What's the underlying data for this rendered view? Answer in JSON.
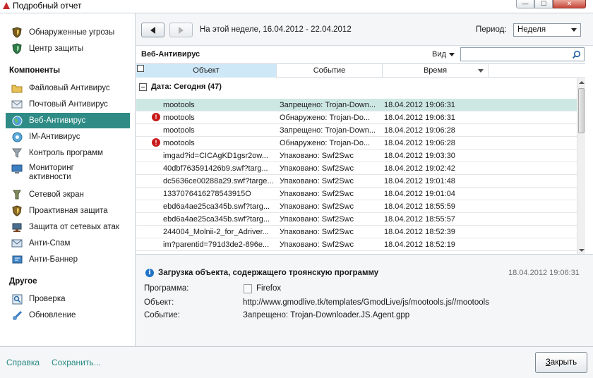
{
  "window": {
    "title": "Подробный отчет",
    "min_glyph": "—",
    "max_glyph": "☐",
    "close_glyph": "✕"
  },
  "sidebar": {
    "top_items": [
      {
        "label": "Обнаруженные угрозы",
        "icon": "shield-threat-icon"
      },
      {
        "label": "Центр защиты",
        "icon": "shield-center-icon"
      }
    ],
    "components_header": "Компоненты",
    "components": [
      {
        "label": "Файловый Антивирус",
        "icon": "folder-icon"
      },
      {
        "label": "Почтовый Антивирус",
        "icon": "envelope-icon"
      },
      {
        "label": "Веб-Антивирус",
        "icon": "globe-icon",
        "selected": true
      },
      {
        "label": "IM-Антивирус",
        "icon": "im-icon"
      },
      {
        "label": "Контроль программ",
        "icon": "filter-icon"
      },
      {
        "label": "Мониторинг активности",
        "icon": "monitor-icon"
      },
      {
        "label": "Сетевой экран",
        "icon": "firewall-icon"
      },
      {
        "label": "Проактивная защита",
        "icon": "proactive-shield-icon"
      },
      {
        "label": "Защита от сетевых атак",
        "icon": "network-attack-icon"
      },
      {
        "label": "Анти-Спам",
        "icon": "antispam-icon"
      },
      {
        "label": "Анти-Баннер",
        "icon": "antibanner-icon"
      }
    ],
    "other_header": "Другое",
    "other": [
      {
        "label": "Проверка",
        "icon": "scan-icon"
      },
      {
        "label": "Обновление",
        "icon": "update-icon"
      }
    ]
  },
  "nav": {
    "period_text": "На этой неделе, 16.04.2012 - 22.04.2012",
    "period_label": "Период:",
    "period_value": "Неделя"
  },
  "section": {
    "title": "Веб-Антивирус",
    "view_label": "Вид",
    "search_placeholder": ""
  },
  "table": {
    "columns": [
      "Объект",
      "Событие",
      "Время"
    ],
    "group_label": "Дата: Сегодня (47)",
    "rows": [
      {
        "object": "mootools",
        "event": "Запрещено: Trojan-Down...",
        "time": "18.04.2012 19:06:31",
        "warn": false,
        "selected": true
      },
      {
        "object": "mootools",
        "event": "Обнаружено: Trojan-Do...",
        "time": "18.04.2012 19:06:31",
        "warn": true
      },
      {
        "object": "mootools",
        "event": "Запрещено: Trojan-Down...",
        "time": "18.04.2012 19:06:28",
        "warn": false
      },
      {
        "object": "mootools",
        "event": "Обнаружено: Trojan-Do...",
        "time": "18.04.2012 19:06:28",
        "warn": true
      },
      {
        "object": "imgad?id=CICAgKD1gsr2ow...",
        "event": "Упаковано: Swf2Swc",
        "time": "18.04.2012 19:03:30",
        "warn": false
      },
      {
        "object": "40dbf763591426b9.swf?targ...",
        "event": "Упаковано: Swf2Swc",
        "time": "18.04.2012 19:02:42",
        "warn": false
      },
      {
        "object": "dc5636ce00288a29.swf?targe...",
        "event": "Упаковано: Swf2Swc",
        "time": "18.04.2012 19:01:48",
        "warn": false
      },
      {
        "object": "1337076416278543915O",
        "event": "Упаковано: Swf2Swc",
        "time": "18.04.2012 19:01:04",
        "warn": false
      },
      {
        "object": "ebd6a4ae25ca345b.swf?targ...",
        "event": "Упаковано: Swf2Swc",
        "time": "18.04.2012 18:55:59",
        "warn": false
      },
      {
        "object": "ebd6a4ae25ca345b.swf?targ...",
        "event": "Упаковано: Swf2Swc",
        "time": "18.04.2012 18:55:57",
        "warn": false
      },
      {
        "object": "244004_Molnii-2_for_Adriver...",
        "event": "Упаковано: Swf2Swc",
        "time": "18.04.2012 18:52:39",
        "warn": false
      },
      {
        "object": "im?parentid=791d3de2-896e...",
        "event": "Упаковано: Swf2Swc",
        "time": "18.04.2012 18:52:19",
        "warn": false
      }
    ]
  },
  "detail": {
    "title": "Загрузка объекта, содержащего троянскую программу",
    "time": "18.04.2012 19:06:31",
    "program_label": "Программа:",
    "program_value": "Firefox",
    "object_label": "Объект:",
    "object_value": "http://www.gmodlive.tk/templates/GmodLive/js/mootools.js//mootools",
    "event_label": "Событие:",
    "event_value": "Запрещено: Trojan-Downloader.JS.Agent.gpp"
  },
  "footer": {
    "help": "Справка",
    "save": "Сохранить...",
    "close": "Закрыть"
  },
  "colors": {
    "accent": "#2e8b85",
    "selected_row": "#cde8e3",
    "link": "#2a8a82",
    "warning": "#c81a1a",
    "info": "#1f73c7"
  }
}
